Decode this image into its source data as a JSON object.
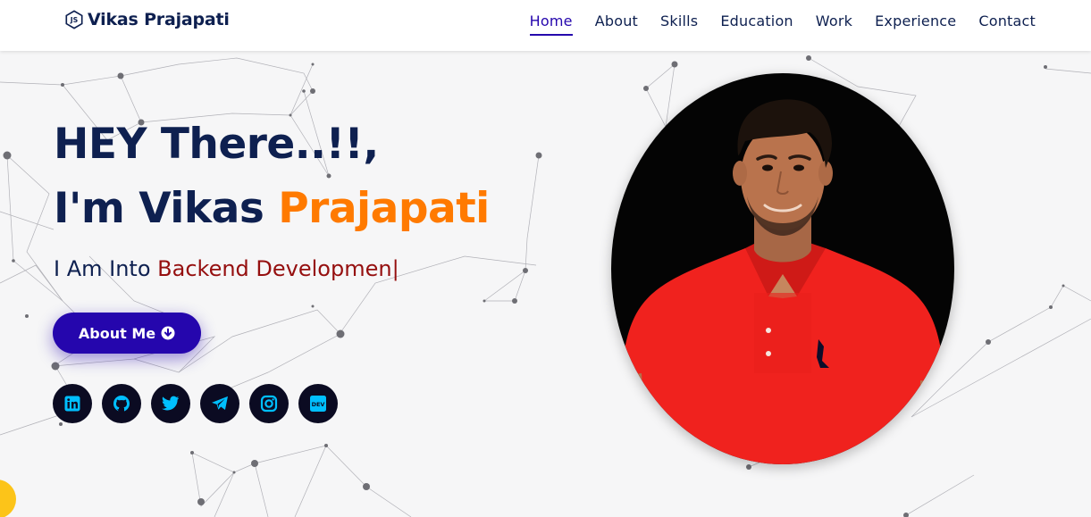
{
  "brand": {
    "name": "Vikas Prajapati",
    "icon": "nodejs-hexagon-icon"
  },
  "nav": {
    "active": "Home",
    "items": [
      "Home",
      "About",
      "Skills",
      "Education",
      "Work",
      "Experience",
      "Contact"
    ]
  },
  "hero": {
    "greeting": "HEY There..!!,",
    "intro_prefix": "I'm Vikas ",
    "intro_accent": "Prajapati",
    "typed_prefix": "I Am Into ",
    "typed_role": "Backend Developmen",
    "typed_cursor": "|",
    "cta_label": "About Me",
    "cta_icon": "arrow-circle-down-icon"
  },
  "socials": [
    {
      "network": "LinkedIn",
      "icon": "linkedin-icon"
    },
    {
      "network": "GitHub",
      "icon": "github-icon"
    },
    {
      "network": "Twitter",
      "icon": "twitter-icon"
    },
    {
      "network": "Telegram",
      "icon": "telegram-icon"
    },
    {
      "network": "Instagram",
      "icon": "instagram-icon"
    },
    {
      "network": "DEV",
      "icon": "dev-icon",
      "label": "DEV"
    }
  ],
  "colors": {
    "navy": "#0e2050",
    "primary": "#2506ad",
    "accent_orange": "#ff7a00",
    "accent_red": "#950f0f",
    "social_bg": "#0b0b22",
    "social_icon": "#00bfff",
    "chat_fab": "#fcc419"
  }
}
